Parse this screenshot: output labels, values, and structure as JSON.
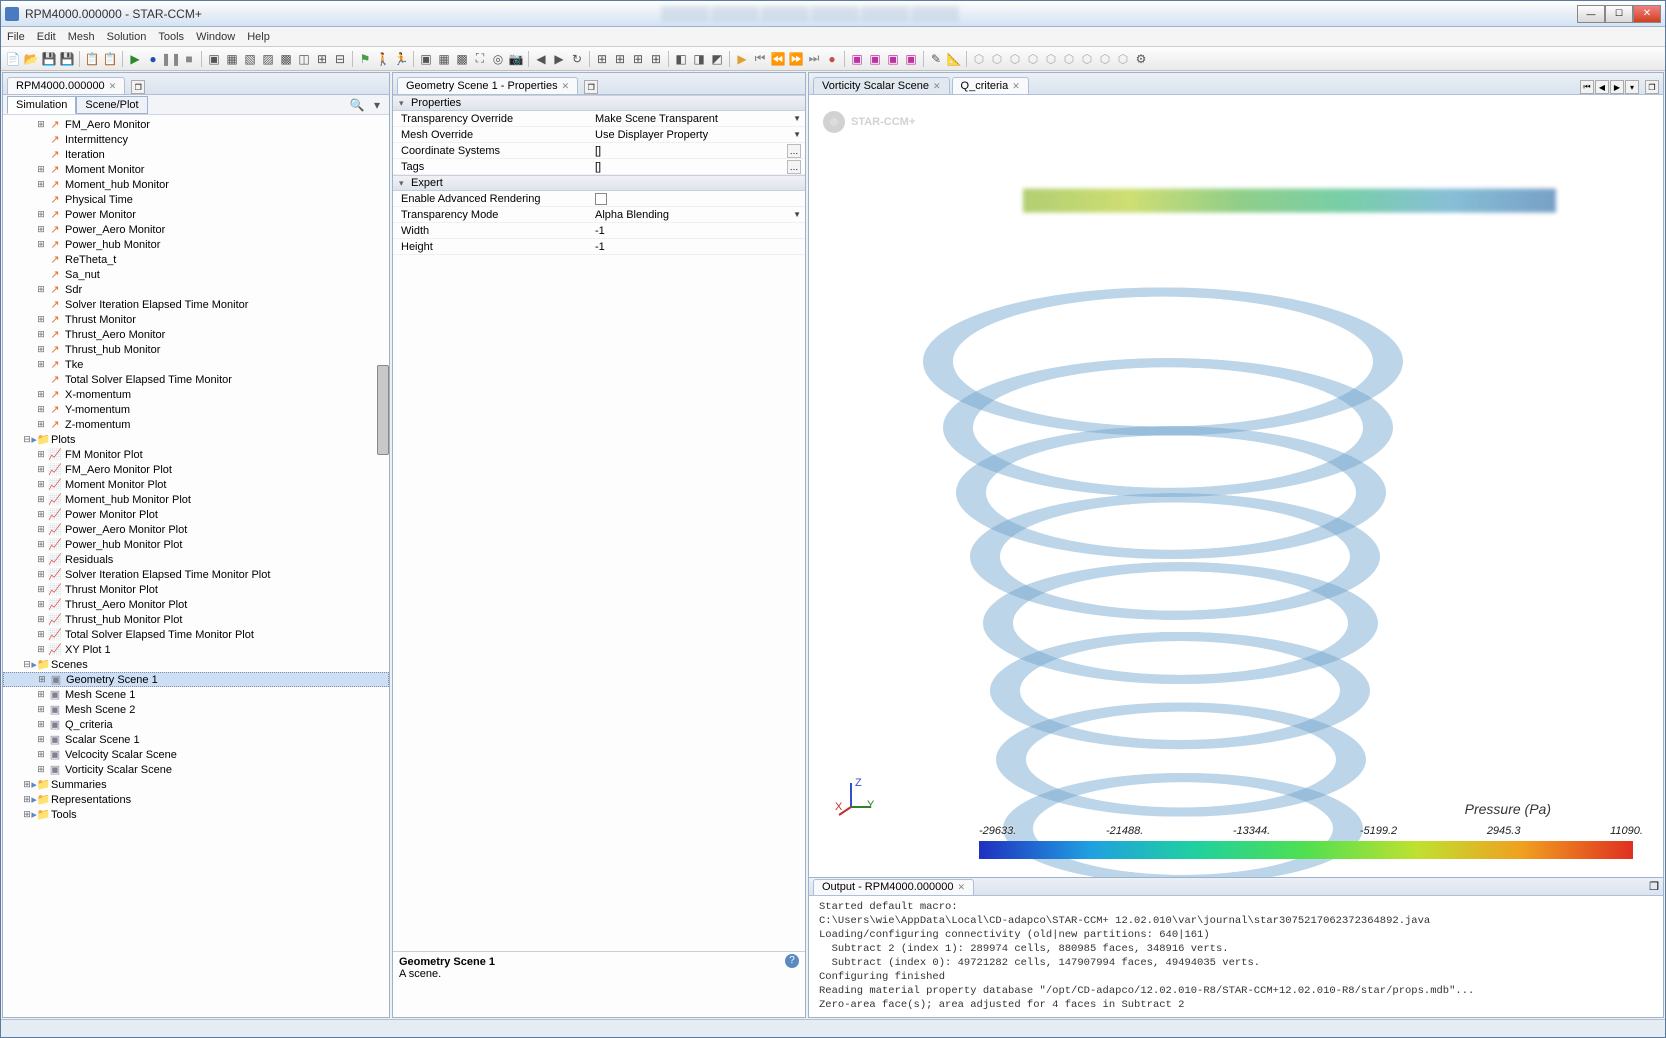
{
  "window": {
    "title": "RPM4000.000000 - STAR-CCM+"
  },
  "menubar": [
    "File",
    "Edit",
    "Mesh",
    "Solution",
    "Tools",
    "Window",
    "Help"
  ],
  "doc_tab": "RPM4000.000000",
  "sim_tabs": {
    "a": "Simulation",
    "b": "Scene/Plot"
  },
  "tree": {
    "monitors": [
      "FM_Aero Monitor",
      "Intermittency",
      "Iteration",
      "Moment Monitor",
      "Moment_hub Monitor",
      "Physical Time",
      "Power Monitor",
      "Power_Aero Monitor",
      "Power_hub Monitor",
      "ReTheta_t",
      "Sa_nut",
      "Sdr",
      "Solver Iteration Elapsed Time Monitor",
      "Thrust Monitor",
      "Thrust_Aero Monitor",
      "Thrust_hub Monitor",
      "Tke",
      "Total Solver Elapsed Time Monitor",
      "X-momentum",
      "Y-momentum",
      "Z-momentum"
    ],
    "plots_label": "Plots",
    "plots": [
      "FM Monitor Plot",
      "FM_Aero Monitor Plot",
      "Moment Monitor Plot",
      "Moment_hub Monitor Plot",
      "Power Monitor Plot",
      "Power_Aero Monitor Plot",
      "Power_hub Monitor Plot",
      "Residuals",
      "Solver Iteration Elapsed Time Monitor Plot",
      "Thrust Monitor Plot",
      "Thrust_Aero Monitor Plot",
      "Thrust_hub Monitor Plot",
      "Total Solver Elapsed Time Monitor Plot",
      "XY Plot 1"
    ],
    "scenes_label": "Scenes",
    "scenes": [
      "Geometry Scene 1",
      "Mesh Scene 1",
      "Mesh Scene 2",
      "Q_criteria",
      "Scalar Scene 1",
      "Velcocity Scalar Scene",
      "Vorticity Scalar Scene"
    ],
    "summaries": "Summaries",
    "representations": "Representations",
    "tools": "Tools"
  },
  "props": {
    "title": "Geometry Scene 1 - Properties",
    "section1": "Properties",
    "rows": [
      {
        "k": "Transparency Override",
        "v": "Make Scene Transparent",
        "t": "dd"
      },
      {
        "k": "Mesh Override",
        "v": "Use Displayer Property",
        "t": "dd"
      },
      {
        "k": "Coordinate Systems",
        "v": "[]",
        "t": "el"
      },
      {
        "k": "Tags",
        "v": "[]",
        "t": "el"
      }
    ],
    "section2": "Expert",
    "rows2": [
      {
        "k": "Enable Advanced Rendering",
        "v": "",
        "t": "chk"
      },
      {
        "k": "Transparency Mode",
        "v": "Alpha Blending",
        "t": "dd"
      },
      {
        "k": "Width",
        "v": "-1",
        "t": "txt"
      },
      {
        "k": "Height",
        "v": "-1",
        "t": "txt"
      }
    ],
    "desc_title": "Geometry Scene 1",
    "desc_body": "A scene."
  },
  "scene_tabs": {
    "a": "Vorticity Scalar Scene",
    "b": "Q_criteria"
  },
  "watermark": "STAR-CCM+",
  "triad": {
    "x": "X",
    "y": "Y",
    "z": "Z"
  },
  "legend": {
    "title": "Pressure (Pa)",
    "ticks": [
      "-29633.",
      "-21488.",
      "-13344.",
      "-5199.2",
      "2945.3",
      "11090."
    ]
  },
  "output": {
    "title": "Output - RPM4000.000000",
    "lines": [
      "Started default macro:",
      "C:\\Users\\wie\\AppData\\Local\\CD-adapco\\STAR-CCM+ 12.02.010\\var\\journal\\star3075217062372364892.java",
      "Loading/configuring connectivity (old|new partitions: 640|161)",
      "  Subtract 2 (index 1): 289974 cells, 880985 faces, 348916 verts.",
      "  Subtract (index 0): 49721282 cells, 147907994 faces, 49494035 verts.",
      "Configuring finished",
      "Reading material property database \"/opt/CD-adapco/12.02.010-R8/STAR-CCM+12.02.010-R8/star/props.mdb\"...",
      "Zero-area face(s); area adjusted for 4 faces in Subtract 2"
    ]
  },
  "chart_data": {
    "type": "colorbar",
    "title": "Pressure (Pa)",
    "min": -29633,
    "max": 11090,
    "ticks": [
      -29633,
      -21488,
      -13344,
      -5199.2,
      2945.3,
      11090
    ],
    "colormap": "jet"
  }
}
